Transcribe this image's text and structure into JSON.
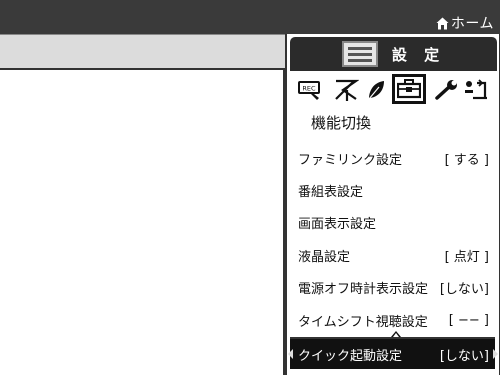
{
  "header": {
    "home_label": "ホーム"
  },
  "panel": {
    "title": "設 定",
    "section_label": "機能切換",
    "category_icons": [
      "rec-icon",
      "antenna-off-icon",
      "leaf-icon",
      "toolbox-icon",
      "wrench-icon",
      "person-antenna-icon"
    ],
    "selected_category": "toolbox-icon"
  },
  "menu": {
    "items": [
      {
        "label": "ファミリンク設定",
        "value": "[ する ]"
      },
      {
        "label": "番組表設定",
        "value": ""
      },
      {
        "label": "画面表示設定",
        "value": ""
      },
      {
        "label": "液晶設定",
        "value": "[ 点灯 ]"
      },
      {
        "label": "電源オフ時計表示設定",
        "value": "[しない]"
      },
      {
        "label": "タイムシフト視聴設定",
        "value": "[ −− ]"
      },
      {
        "label": "クイック起動設定",
        "value": "[しない]"
      }
    ],
    "selected_index": 6
  },
  "colors": {
    "header_bg": "#3a3a3a",
    "panel_header_bg": "#2b2b2b",
    "strip_bg": "#dcdcdc",
    "selected_bg": "#111111"
  }
}
